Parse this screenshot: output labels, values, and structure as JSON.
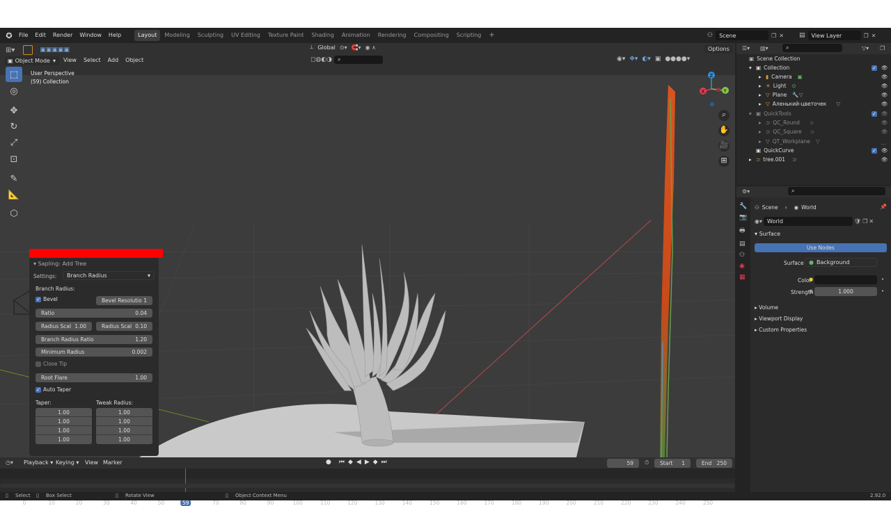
{
  "menu": [
    "File",
    "Edit",
    "Render",
    "Window",
    "Help"
  ],
  "workspaces": [
    {
      "label": "Layout",
      "active": true
    },
    {
      "label": "Modeling",
      "active": false
    },
    {
      "label": "Sculpting",
      "active": false
    },
    {
      "label": "UV Editing",
      "active": false
    },
    {
      "label": "Texture Paint",
      "active": false
    },
    {
      "label": "Shading",
      "active": false
    },
    {
      "label": "Animation",
      "active": false
    },
    {
      "label": "Rendering",
      "active": false
    },
    {
      "label": "Compositing",
      "active": false
    },
    {
      "label": "Scripting",
      "active": false
    }
  ],
  "scene_field": "Scene",
  "view_layer_field": "View Layer",
  "viewport": {
    "transform_orientation": "Global",
    "options_label": "Options",
    "mode": "Object Mode",
    "header_menus": [
      "View",
      "Select",
      "Add",
      "Object"
    ],
    "perspective_label": "User Perspective",
    "collection_label": "(59) Collection"
  },
  "redo_panel": {
    "title": "Sapling: Add Tree",
    "settings_label": "Settings:",
    "settings_value": "Branch Radius",
    "section": "Branch Radius:",
    "bevel_label": "Bevel",
    "bevel_resolution_label": "Bevel Resolutio",
    "bevel_resolution_value": "1",
    "ratio_label": "Ratio",
    "ratio_value": "0.04",
    "radius_scale_a_label": "Radius Scal",
    "radius_scale_a_value": "1.00",
    "radius_scale_b_label": "Radius Scal",
    "radius_scale_b_value": "0.10",
    "branch_radius_ratio_label": "Branch Radius Ratio",
    "branch_radius_ratio_value": "1.20",
    "minimum_radius_label": "Minimum Radius",
    "minimum_radius_value": "0.002",
    "close_tip_label": "Close Tip",
    "root_flare_label": "Root Flare",
    "root_flare_value": "1.00",
    "auto_taper_label": "Auto Taper",
    "taper_label": "Taper:",
    "tweak_radius_label": "Tweak Radius:",
    "taper_values": [
      "1.00",
      "1.00",
      "1.00",
      "1.00"
    ],
    "tweak_values": [
      "1.00",
      "1.00",
      "1.00",
      "1.00"
    ]
  },
  "outliner": {
    "root": "Scene Collection",
    "items": [
      {
        "label": "Collection",
        "muted": false
      },
      {
        "label": "Camera",
        "muted": false
      },
      {
        "label": "Light",
        "muted": false
      },
      {
        "label": "Plane",
        "muted": false
      },
      {
        "label": "Аленький-цветочек",
        "muted": false
      },
      {
        "label": "QuickTools",
        "muted": true
      },
      {
        "label": "QC_Round",
        "muted": true
      },
      {
        "label": "QC_Square",
        "muted": true
      },
      {
        "label": "QT_Workplane",
        "muted": true
      },
      {
        "label": "QuickCurve",
        "muted": false
      },
      {
        "label": "tree.001",
        "muted": false
      }
    ]
  },
  "properties": {
    "breadcrumb_scene": "Scene",
    "breadcrumb_world": "World",
    "world_name": "World",
    "surface_section": "Surface",
    "use_nodes_label": "Use Nodes",
    "surface_label": "Surface",
    "surface_value": "Background",
    "color_label": "Color",
    "strength_label": "Strength",
    "strength_value": "1.000",
    "sections": [
      "Volume",
      "Viewport Display",
      "Custom Properties"
    ]
  },
  "timeline": {
    "menus": [
      "Playback",
      "Keying",
      "View",
      "Marker"
    ],
    "current_frame": "59",
    "start_label": "Start",
    "start_value": "1",
    "end_label": "End",
    "end_value": "250",
    "ticks": [
      "0",
      "10",
      "20",
      "30",
      "40",
      "50",
      "59",
      "70",
      "80",
      "90",
      "100",
      "110",
      "120",
      "130",
      "140",
      "150",
      "160",
      "170",
      "180",
      "190",
      "200",
      "210",
      "220",
      "230",
      "240",
      "250"
    ]
  },
  "statusbar": {
    "select": "Select",
    "box_select": "Box Select",
    "rotate_view": "Rotate View",
    "context_menu": "Object Context Menu",
    "version": "2.92.0"
  },
  "colors": {
    "accent": "#4772b3",
    "redo_header": "#ff0000",
    "x_axis": "#e8394d",
    "y_axis": "#8bc34a",
    "z_axis": "#2f8fe0"
  }
}
